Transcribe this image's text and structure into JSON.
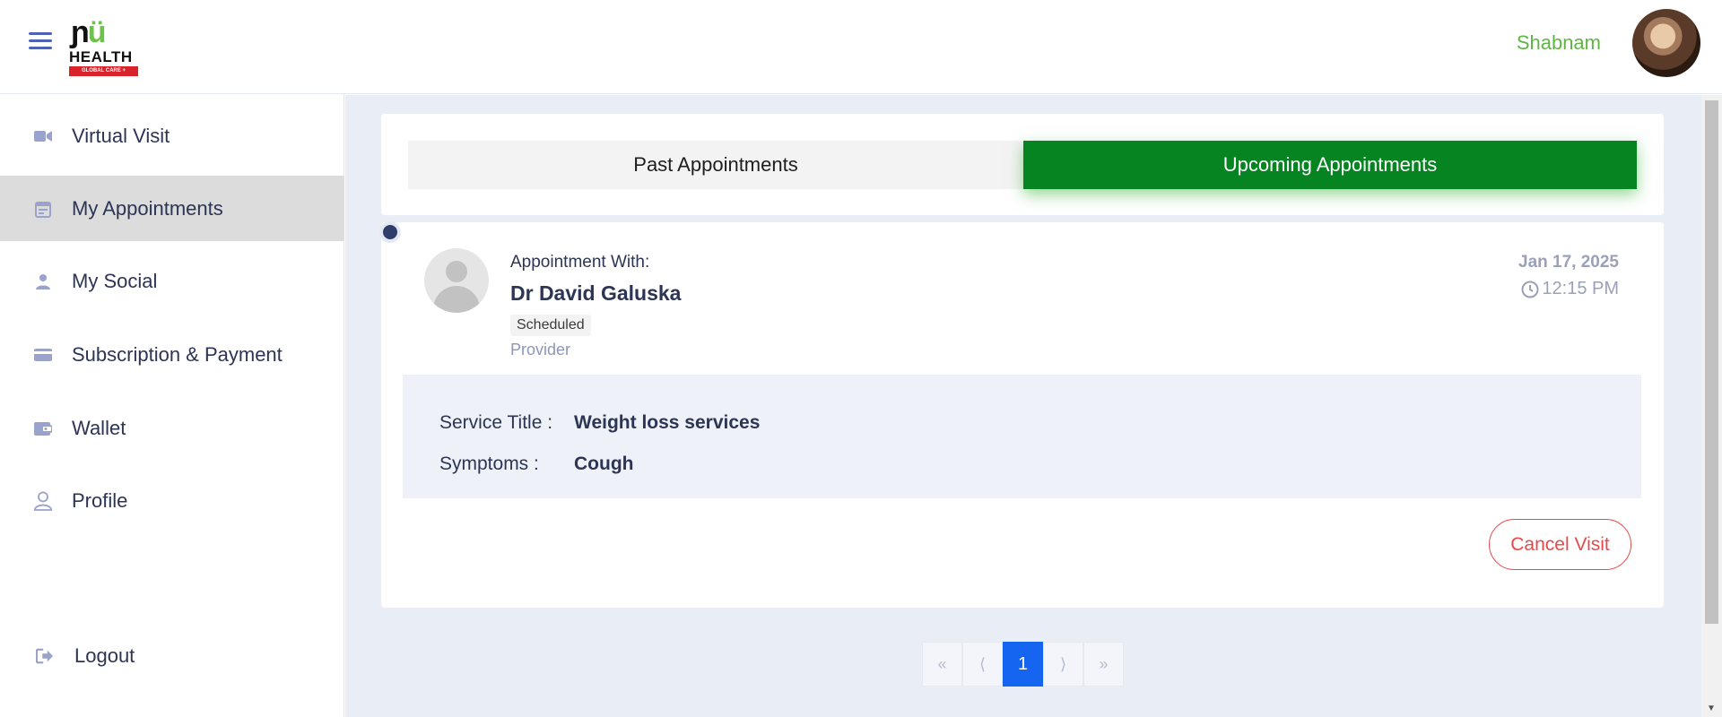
{
  "header": {
    "logo": {
      "mark_left": "ɲ",
      "mark_right": "ü",
      "word": "HEALTH",
      "tagline": "GLOBAL CARE +"
    },
    "username": "Shabnam"
  },
  "sidebar": {
    "items": [
      {
        "label": "Virtual Visit",
        "icon": "video-camera-icon"
      },
      {
        "label": "My Appointments",
        "icon": "calendar-icon",
        "active": true
      },
      {
        "label": "My Social",
        "icon": "person-icon"
      },
      {
        "label": "Subscription & Payment",
        "icon": "credit-card-icon"
      },
      {
        "label": "Wallet",
        "icon": "wallet-icon"
      },
      {
        "label": "Profile",
        "icon": "profile-icon"
      }
    ],
    "logout": {
      "label": "Logout",
      "icon": "logout-icon"
    }
  },
  "tabs": {
    "past": "Past Appointments",
    "upcoming": "Upcoming Appointments",
    "active": "upcoming"
  },
  "appointment": {
    "with_label": "Appointment With:",
    "provider_name": "Dr David Galuska",
    "status": "Scheduled",
    "role": "Provider",
    "date": "Jan 17, 2025",
    "time": "12:15 PM",
    "service_title_label": "Service Title :",
    "service_title": "Weight loss services",
    "symptoms_label": "Symptoms :",
    "symptoms": "Cough",
    "cancel_label": "Cancel Visit"
  },
  "pagination": {
    "first": "«",
    "prev": "⟨",
    "current": "1",
    "next": "⟩",
    "last": "»"
  },
  "colors": {
    "brand_green": "#068422",
    "username_green": "#5fb544",
    "danger": "#e64a4a",
    "pager_active": "#1565f0",
    "nav_icon": "#9aa3cc"
  }
}
